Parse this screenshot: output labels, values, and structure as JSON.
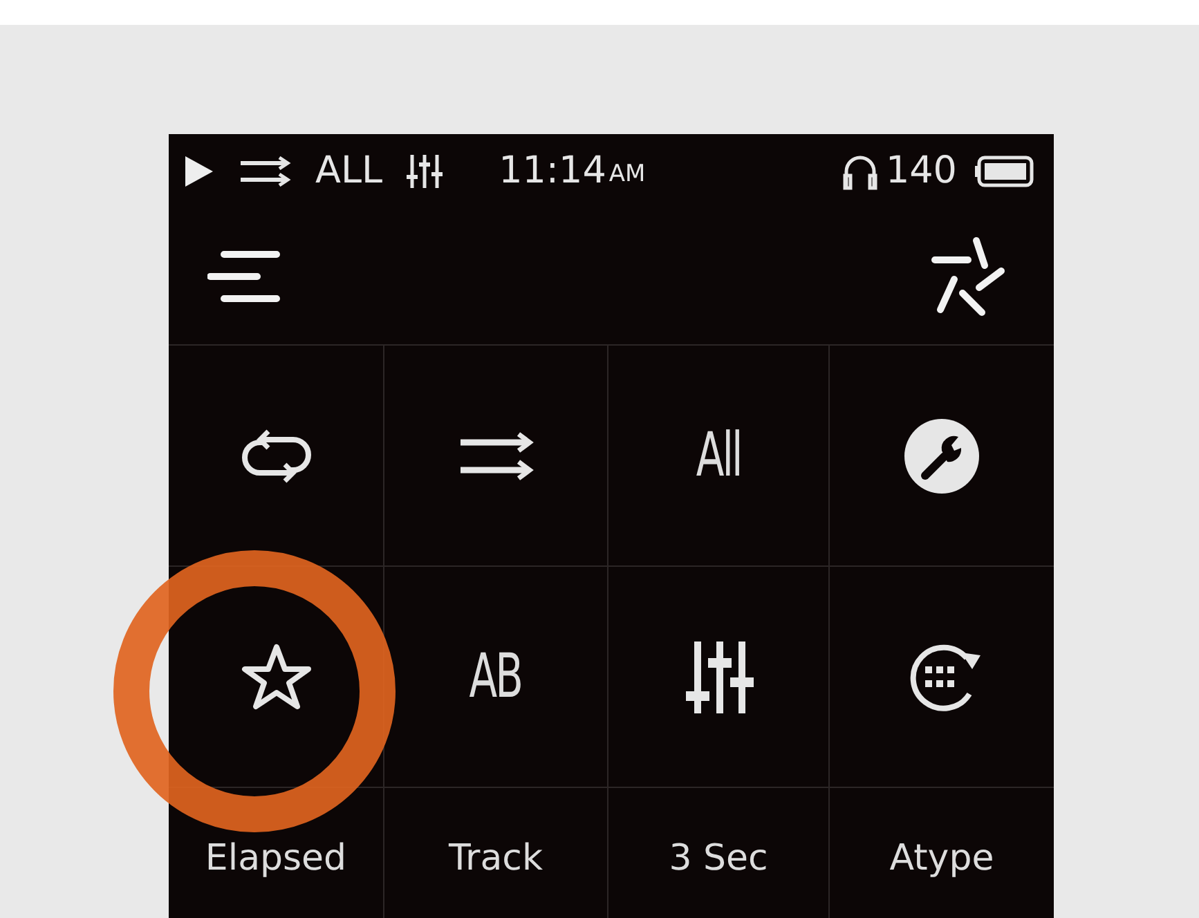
{
  "status_bar": {
    "repeat_mode": "ALL",
    "time": "11:14",
    "meridiem": "AM",
    "volume": "140"
  },
  "tiles": [
    {
      "kind": "repeat",
      "highlighted": false
    },
    {
      "kind": "shuffle",
      "highlighted": false
    },
    {
      "kind": "glyph",
      "glyph": "All",
      "highlighted": false
    },
    {
      "kind": "settings",
      "highlighted": false
    },
    {
      "kind": "star",
      "highlighted": true
    },
    {
      "kind": "glyph",
      "glyph": "AB",
      "highlighted": false
    },
    {
      "kind": "equalizer",
      "highlighted": false
    },
    {
      "kind": "player",
      "highlighted": false
    },
    {
      "kind": "label",
      "label": "Elapsed",
      "highlighted": false
    },
    {
      "kind": "label",
      "label": "Track",
      "highlighted": false
    },
    {
      "kind": "label",
      "label": "3 Sec",
      "highlighted": false
    },
    {
      "kind": "label",
      "label": "Atype",
      "highlighted": false
    }
  ]
}
